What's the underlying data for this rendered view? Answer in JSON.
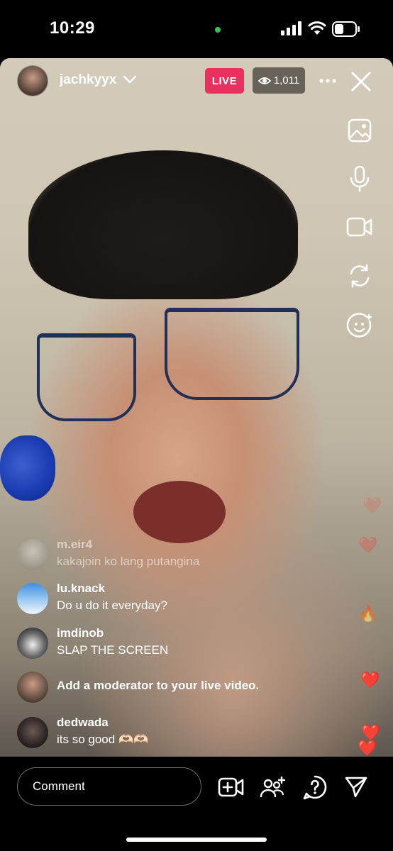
{
  "status_bar": {
    "time": "10:29"
  },
  "header": {
    "username": "jachkyyx",
    "live_label": "LIVE",
    "viewer_count": "1,011"
  },
  "comments": [
    {
      "user": "m.eir4",
      "text": "kakajoin ko lang putangina"
    },
    {
      "user": "lu.knack",
      "text": "Do u do it everyday?"
    },
    {
      "user": "imdinob",
      "text": "SLAP THE SCREEN"
    },
    {
      "system": "Add a moderator to your live video."
    },
    {
      "user": "dedwada",
      "text": "its so good 🫶🏻🫶🏻"
    }
  ],
  "composer": {
    "placeholder": "Comment"
  },
  "icons": {
    "side_tools": [
      "image-icon",
      "microphone-icon",
      "video-camera-icon",
      "flip-camera-icon",
      "face-effects-icon"
    ],
    "bottom": [
      "add-video-icon",
      "add-guest-icon",
      "question-icon",
      "send-icon"
    ]
  },
  "colors": {
    "live_badge": "#e8315e",
    "heart": "#e8394a"
  }
}
